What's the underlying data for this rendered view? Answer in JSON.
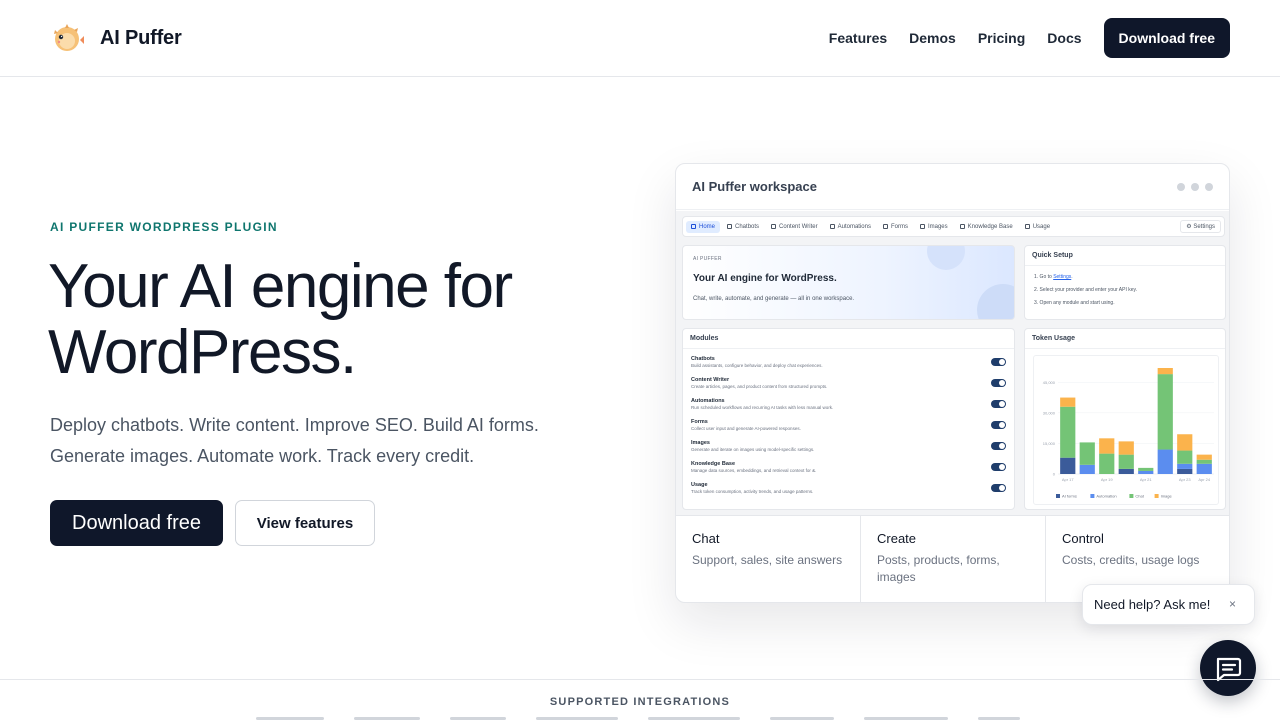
{
  "brand": {
    "name": "AI Puffer",
    "logo_icon": "pufferfish-logo-icon"
  },
  "nav": {
    "links": [
      "Features",
      "Demos",
      "Pricing",
      "Docs"
    ],
    "cta": "Download free"
  },
  "hero": {
    "eyebrow": "AI PUFFER WORDPRESS PLUGIN",
    "title_line1": "Your AI engine for",
    "title_line2": "WordPress.",
    "subtitle_line1": "Deploy chatbots. Write content. Improve SEO. Build AI forms.",
    "subtitle_line2": "Generate images. Automate work. Track every credit.",
    "primary_button": "Download free",
    "secondary_button": "View features"
  },
  "workspace": {
    "title": "AI Puffer workspace",
    "tabs": [
      "Home",
      "Chatbots",
      "Content Writer",
      "Automations",
      "Forms",
      "Images",
      "Knowledge Base",
      "Usage"
    ],
    "active_tab": "Home",
    "settings_label": "Settings",
    "banner": {
      "eyebrow": "AI PUFFER",
      "title": "Your AI engine for WordPress.",
      "subtitle": "Chat, write, automate, and generate — all in one workspace."
    },
    "quick_setup": {
      "title": "Quick Setup",
      "step1_prefix": "1. Go to ",
      "step1_link": "Settings",
      "step1_suffix": ".",
      "step2": "2. Select your provider and enter your API key.",
      "step3": "3. Open any module and start using."
    },
    "modules": {
      "title": "Modules",
      "items": [
        {
          "name": "Chatbots",
          "desc": "Build assistants, configure behavior, and deploy chat experiences.",
          "enabled": true
        },
        {
          "name": "Content Writer",
          "desc": "Create articles, pages, and product content from structured prompts.",
          "enabled": true
        },
        {
          "name": "Automations",
          "desc": "Run scheduled workflows and recurring AI tasks with less manual work.",
          "enabled": true
        },
        {
          "name": "Forms",
          "desc": "Collect user input and generate AI-powered responses.",
          "enabled": true
        },
        {
          "name": "Images",
          "desc": "Generate and iterate on images using model-specific settings.",
          "enabled": true
        },
        {
          "name": "Knowledge Base",
          "desc": "Manage data sources, embeddings, and retrieval context for &.",
          "enabled": true
        },
        {
          "name": "Usage",
          "desc": "Track token consumption, activity trends, and usage patterns.",
          "enabled": true
        }
      ]
    },
    "token_usage": {
      "title": "Token Usage"
    },
    "features": [
      {
        "title": "Chat",
        "desc": "Support, sales, site answers"
      },
      {
        "title": "Create",
        "desc": "Posts, products, forms, images"
      },
      {
        "title": "Control",
        "desc": "Costs, credits, usage logs"
      }
    ]
  },
  "chart_data": {
    "type": "bar",
    "stacked": true,
    "title": "Token Usage",
    "categories": [
      "Apr 17",
      "Apr 18",
      "Apr 19",
      "Apr 20",
      "Apr 21",
      "Apr 22",
      "Apr 23",
      "Apr 24"
    ],
    "tick_labels_x": [
      "Apr 17",
      "Apr 19",
      "Apr 21",
      "Apr 23",
      "Apr 24"
    ],
    "y_ticks": [
      "0",
      "15,000",
      "30,000",
      "45,000"
    ],
    "ylim": [
      0,
      52000
    ],
    "legend": "bottom",
    "series": [
      {
        "name": "AI forms",
        "color": "#3b5b9a",
        "values": [
          8000,
          0,
          0,
          2500,
          0,
          0,
          2500,
          0
        ]
      },
      {
        "name": "Automation",
        "color": "#5b8def",
        "values": [
          0,
          4500,
          0,
          0,
          1500,
          12000,
          2500,
          5000
        ]
      },
      {
        "name": "Chat",
        "color": "#74c476",
        "values": [
          25000,
          11000,
          10000,
          7000,
          1500,
          37000,
          6500,
          2000
        ]
      },
      {
        "name": "Image",
        "color": "#fbb34c",
        "values": [
          4500,
          0,
          7500,
          6500,
          0,
          3000,
          8000,
          2500
        ]
      }
    ]
  },
  "help": {
    "bubble_text": "Need help? Ask me!",
    "close_label": "×",
    "fab_icon": "chat-bubble-icon"
  },
  "integrations": {
    "label": "SUPPORTED INTEGRATIONS"
  }
}
